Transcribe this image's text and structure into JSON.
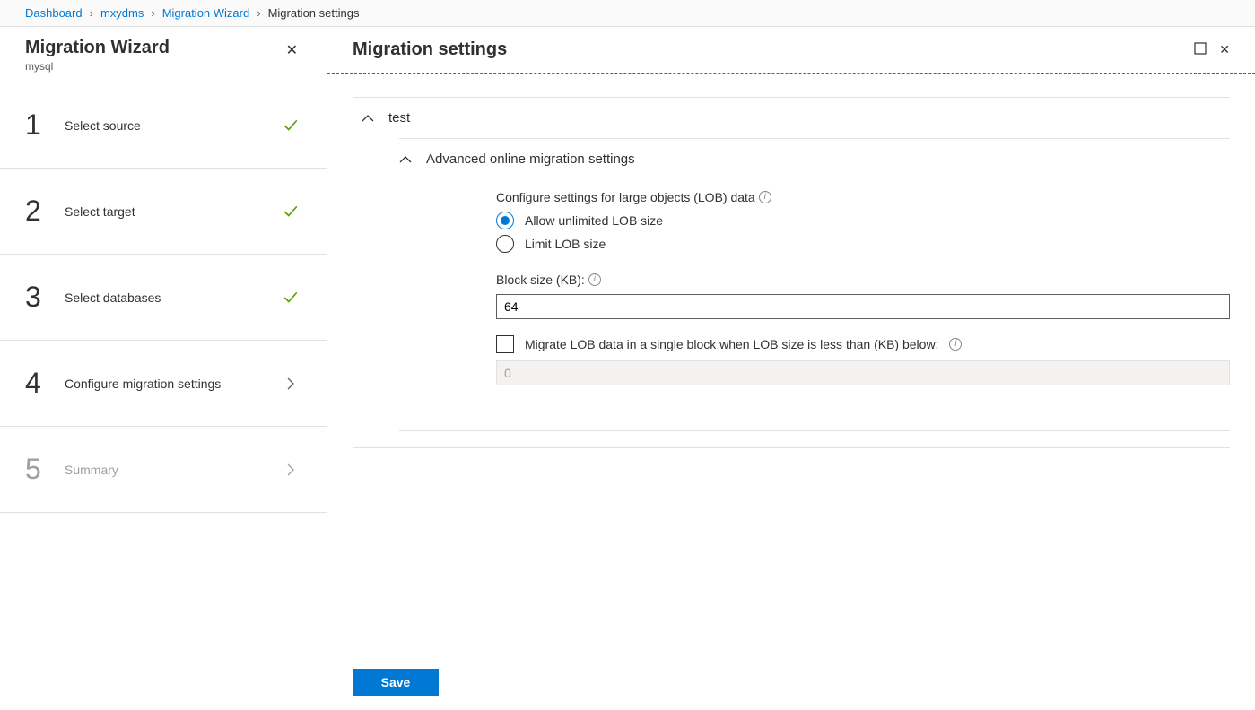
{
  "breadcrumb": {
    "items": [
      {
        "label": "Dashboard",
        "link": true
      },
      {
        "label": "mxydms",
        "link": true
      },
      {
        "label": "Migration Wizard",
        "link": true
      },
      {
        "label": "Migration settings",
        "link": false
      }
    ]
  },
  "sidebar": {
    "title": "Migration Wizard",
    "subtitle": "mysql",
    "steps": [
      {
        "num": "1",
        "label": "Select source",
        "status": "done"
      },
      {
        "num": "2",
        "label": "Select target",
        "status": "done"
      },
      {
        "num": "3",
        "label": "Select databases",
        "status": "done"
      },
      {
        "num": "4",
        "label": "Configure migration settings",
        "status": "current"
      },
      {
        "num": "5",
        "label": "Summary",
        "status": "pending"
      }
    ]
  },
  "main": {
    "title": "Migration settings",
    "db_name": "test",
    "advanced_title": "Advanced online migration settings",
    "lob_heading": "Configure settings for large objects (LOB) data",
    "radio_unlimited": "Allow unlimited LOB size",
    "radio_limit": "Limit LOB size",
    "block_label": "Block size (KB):",
    "block_value": "64",
    "migrate_single_label": "Migrate LOB data in a single block when LOB size is less than (KB) below:",
    "threshold_value": "0",
    "save_label": "Save"
  }
}
